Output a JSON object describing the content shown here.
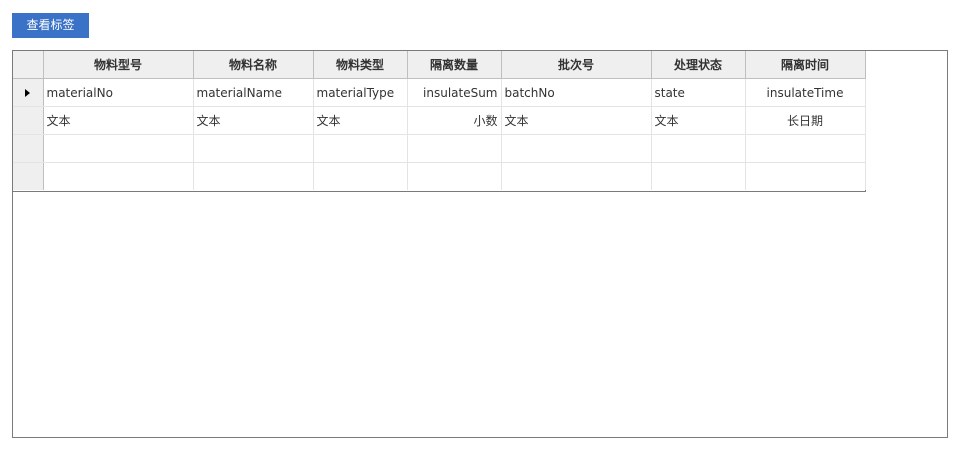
{
  "toolbar": {
    "view_labels_button": "查看标签"
  },
  "grid": {
    "columns": [
      "物料型号",
      "物料名称",
      "物料类型",
      "隔离数量",
      "批次号",
      "处理状态",
      "隔离时间"
    ],
    "rows": [
      {
        "current": true,
        "cells": [
          "materialNo",
          "materialName",
          "materialType",
          "insulateSum",
          "batchNo",
          "state",
          "insulateTime"
        ]
      },
      {
        "current": false,
        "cells": [
          "文本",
          "文本",
          "文本",
          "小数",
          "文本",
          "文本",
          "长日期"
        ]
      },
      {
        "current": false,
        "cells": [
          "",
          "",
          "",
          "",
          "",
          "",
          ""
        ]
      },
      {
        "current": false,
        "cells": [
          "",
          "",
          "",
          "",
          "",
          "",
          ""
        ]
      }
    ]
  },
  "colors": {
    "button_bg": "#3a72c7",
    "header_bg": "#efefef"
  },
  "icons": {
    "current_row": "current-row-arrow-icon"
  }
}
